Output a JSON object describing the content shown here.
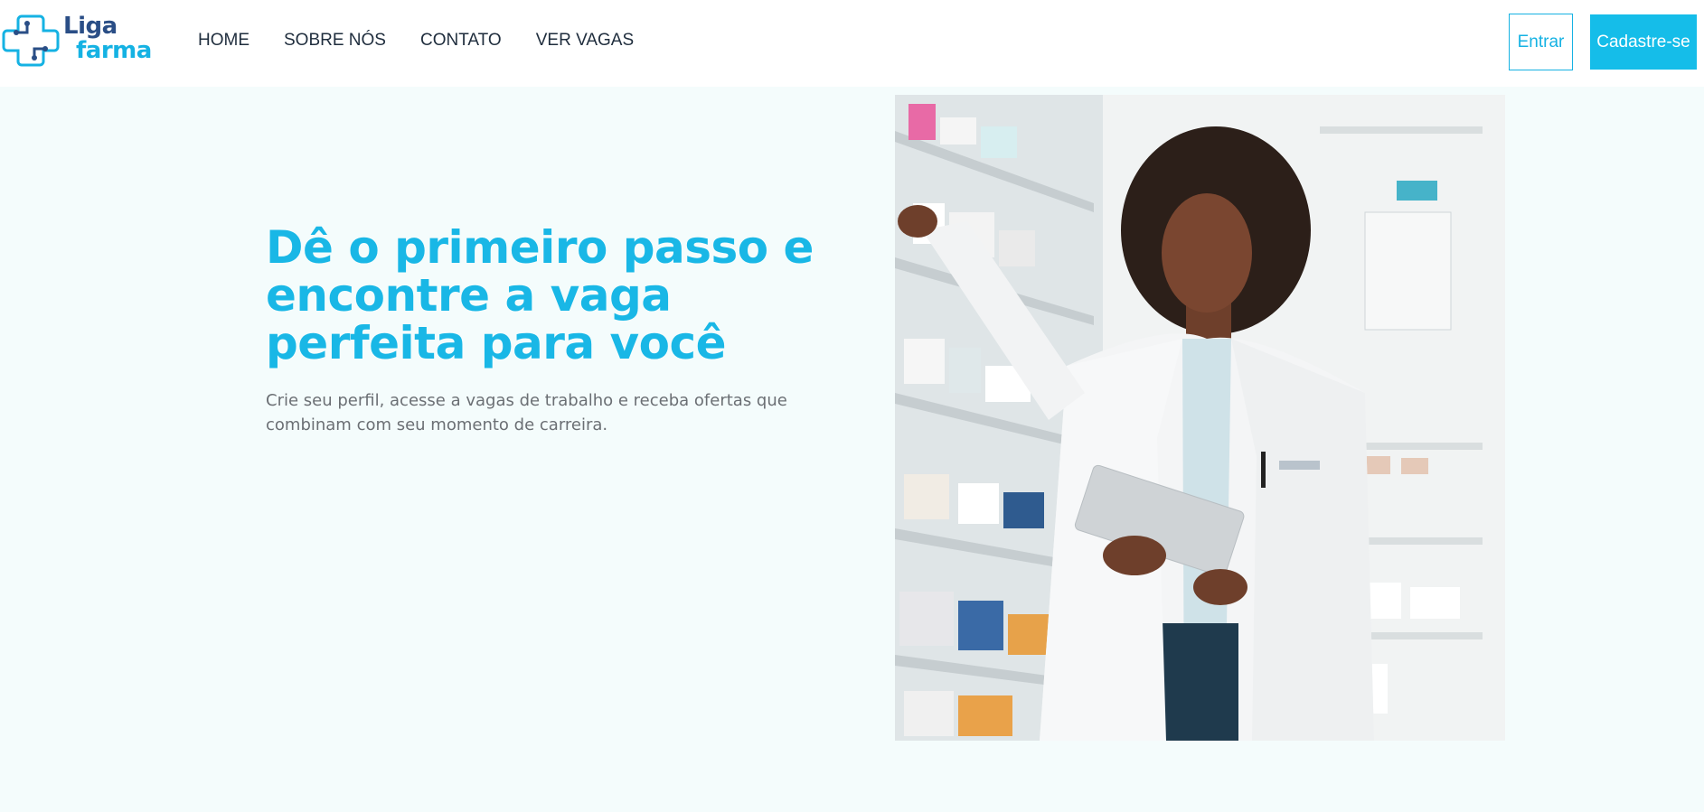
{
  "brand": {
    "name_line1": "Liga",
    "name_line2": "farma",
    "primary_color": "#15b2e3",
    "dark_color": "#2a4e86",
    "logo_icon": "medical-cross-icon"
  },
  "nav": {
    "items": [
      {
        "label": "HOME"
      },
      {
        "label": "SOBRE NÓS"
      },
      {
        "label": "CONTATO"
      },
      {
        "label": "VER VAGAS"
      }
    ]
  },
  "auth": {
    "login_label": "Entrar",
    "signup_label": "Cadastre-se"
  },
  "hero": {
    "title": "Dê o primeiro passo e encontre a vaga perfeita para você",
    "subtitle": "Crie seu perfil, acesse a vagas de trabalho e receba ofertas que combinam com seu momento de carreira.",
    "image_subject": "pharmacist-with-tablet-photo"
  },
  "colors": {
    "page_background": "#f4fcfc",
    "heading": "#19b7e6",
    "body_text": "#6b6f74"
  }
}
